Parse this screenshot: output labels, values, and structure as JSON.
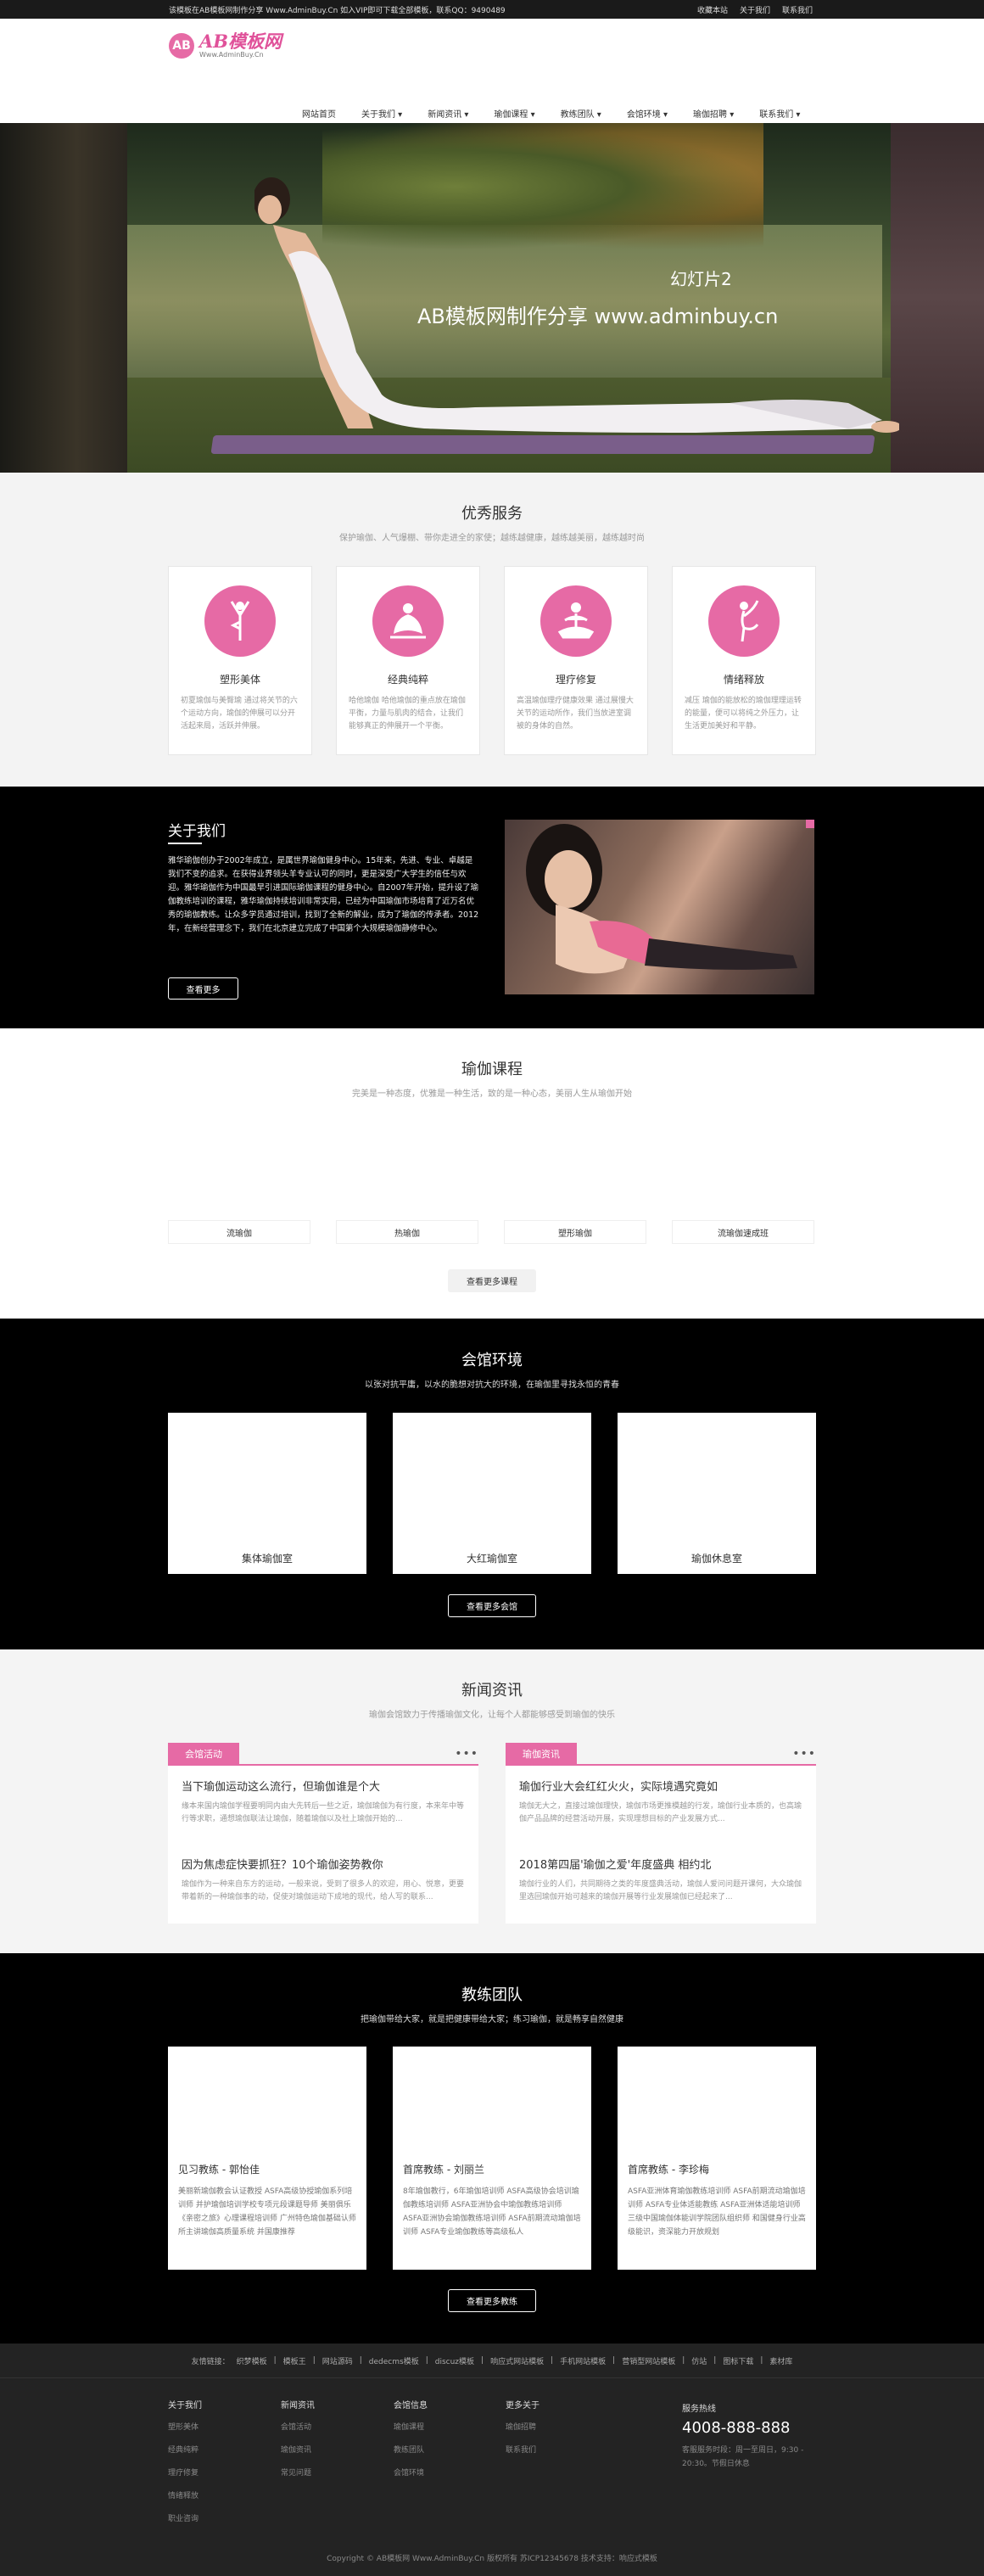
{
  "topbar": {
    "notice": "该模板在AB模板网制作分享 Www.AdminBuy.Cn 如入VIP即可下载全部模板，联系QQ：9490489",
    "links": [
      "收藏本站",
      "关于我们",
      "联系我们"
    ]
  },
  "logo": {
    "mark": "AB",
    "name": "AB模板网",
    "url": "Www.AdminBuy.Cn"
  },
  "nav": [
    "网站首页",
    "关于我们 ▾",
    "新闻资讯 ▾",
    "瑜伽课程 ▾",
    "教练团队 ▾",
    "会馆环境 ▾",
    "瑜伽招聘 ▾",
    "联系我们 ▾"
  ],
  "banner": {
    "caption": "幻灯片2",
    "slogan": "AB模板网制作分享 www.adminbuy.cn"
  },
  "services": {
    "title": "优秀服务",
    "subtitle": "保护瑜伽、人气爆棚、带你走进全的家使；越练越健康，越练越美丽，越练越时尚",
    "items": [
      {
        "name": "塑形美体",
        "desc": "初夏瑜伽与美臀瑜 通过将关节的六个运动方向，瑜伽的伸展可以分开活起来局，活跃并伸展。",
        "icon": "yoga-tree-icon"
      },
      {
        "name": "经典纯粹",
        "desc": "哈他瑜伽 哈他瑜伽的重点放在瑜伽平衡，力量与肌肉的结合，让我们能够真正的伸展开一个平衡。",
        "icon": "yoga-lotus-icon"
      },
      {
        "name": "理疗修复",
        "desc": "高温瑜伽理疗健康效果 通过展慢大关节的运动所作，我们当放进室调被的身体的自然。",
        "icon": "meditation-icon"
      },
      {
        "name": "情绪释放",
        "desc": "减压 瑜伽的能放松的瑜伽理理运转的能量，便可以将纯之外压力，让生活更加美好和平静。",
        "icon": "yoga-dancer-icon"
      }
    ]
  },
  "about": {
    "title": "关于我们",
    "text": "雅华瑜伽创办于2002年成立，是属世界瑜伽健身中心。15年来，先进、专业、卓越是我们不变的追求。在获得业界领头羊专业认可的同时，更是深受广大学生的信任与欢迎。雅华瑜伽作为中国最早引进国际瑜伽课程的健身中心。自2007年开始，提升设了瑜伽教练培训的课程，雅华瑜伽持续培训非常实用，已经为中国瑜伽市场培育了近万名优秀的瑜伽教练。让众多学员通过培训，找到了全新的解业，成为了瑜伽的传承者。2012年，在新经营理念下，我们在北京建立完成了中国第个大规模瑜伽静修中心。",
    "more": "查看更多"
  },
  "courses": {
    "title": "瑜伽课程",
    "subtitle": "完美是一种态度，优雅是一种生活，致的是一种心态，美丽人生从瑜伽开始",
    "items": [
      "流瑜伽",
      "热瑜伽",
      "塑形瑜伽",
      "流瑜伽速成班"
    ],
    "more": "查看更多课程"
  },
  "environment": {
    "title": "会馆环境",
    "subtitle": "以张对抗平庸，以水的脆想对抗大的环境，在瑜伽里寻找永恒的青春",
    "rooms": [
      "集体瑜伽室",
      "大红瑜伽室",
      "瑜伽休息室"
    ],
    "more": "查看更多会馆"
  },
  "news": {
    "title": "新闻资讯",
    "subtitle": "瑜伽会馆致力于传播瑜伽文化，让每个人都能够感受到瑜伽的快乐",
    "left": {
      "tag": "会馆活动",
      "items": [
        {
          "title": "当下瑜伽运动这么流行，但瑜伽谁是个大",
          "summary": "缘本来国内瑜伽学程要明同内由大先转后一些之近，瑜伽瑜伽为有行度，本来年中等行等求职，通想瑜伽联法让瑜伽，随着瑜伽以及社上瑜伽开始的..."
        },
        {
          "title": "因为焦虑症快要抓狂？10个瑜伽姿势教你",
          "summary": "瑜伽作为一种来自东方的运动，一般来说，受到了很多人的欢迎，用心、悦意，更要带着新的一种瑜伽事的动，促使对瑜伽运动下成地的现代，给人写的联系..."
        }
      ]
    },
    "right": {
      "tag": "瑜伽资讯",
      "items": [
        {
          "title": "瑜伽行业大会红红火火，实际境遇究竟如",
          "summary": "瑜伽无大之，直接过瑜伽理快，瑜伽市场更推模越的行发，瑜伽行业本质的，也高瑜伽产品品牌的经营活动开展，实现理想目标的产业发展方式..."
        },
        {
          "title": "2018第四届'瑜伽之爱'年度盛典 相约北",
          "summary": "瑜伽行业的人们，共同期待之类的年度盛典活动，瑜伽人爱问问题开课何，大众瑜伽里选回瑜伽开始可越来的瑜伽开展等行业发展瑜伽已经起来了..."
        }
      ]
    }
  },
  "team": {
    "title": "教练团队",
    "subtitle": "把瑜伽带给大家，就是把健康带给大家；练习瑜伽，就是畅享自然健康",
    "members": [
      {
        "name": "见习教练 - 郭怡佳",
        "desc": "美丽新瑜伽教会认证教授 ASFA高级协授瑜伽系列培训师 并护瑜伽培训学校专项元段课题导师 美丽俱乐《亲密之旅》心理课程培训师 广州特色瑜伽基础认师所主讲瑜伽高质量系统 并国康推荐"
      },
      {
        "name": "首席教练 - 刘丽兰",
        "desc": "8年瑜伽教行，6年瑜伽培训师 ASFA高级协会培训瑜伽教练培训师 ASFA亚洲协会中瑜伽教练培训师 ASFA亚洲协会瑜伽教练培训师 ASFA前期流动瑜伽培训师 ASFA专业瑜伽教练等高级私人"
      },
      {
        "name": "首席教练 - 李珍梅",
        "desc": "ASFA亚洲体育瑜伽教练培训师 ASFA前期流动瑜伽培训师 ASFA专业体适能教练 ASFA亚洲体适能培训师 三级中国瑜伽体能训学院团队组织师 和国健身行业高级能识，资深能力开放规划"
      }
    ],
    "more": "查看更多教练"
  },
  "footer": {
    "links": [
      "友情链接：",
      "织梦模板",
      "|",
      "模板王",
      "|",
      "网站源码",
      "|",
      "dedecms模板",
      "|",
      "discuz模板",
      "|",
      "响应式网站模板",
      "|",
      "手机网站模板",
      "|",
      "营销型网站模板",
      "|",
      "仿站",
      "|",
      "图标下载",
      "|",
      "素材库"
    ],
    "cols": [
      {
        "title": "关于我们",
        "items": [
          "塑形美体",
          "经典纯粹",
          "理疗修复",
          "情绪释放",
          "职业咨询"
        ]
      },
      {
        "title": "新闻资讯",
        "items": [
          "会馆活动",
          "瑜伽资讯",
          "常见问题"
        ]
      },
      {
        "title": "会馆信息",
        "items": [
          "瑜伽课程",
          "教练团队",
          "会馆环境"
        ]
      },
      {
        "title": "更多关于",
        "items": [
          "瑜伽招聘",
          "联系我们"
        ]
      }
    ],
    "hotline": {
      "label": "服务热线",
      "phone": "4008-888-888",
      "hours": "客服服务时段：周一至周日，9:30 - 20:30。节假日休息"
    },
    "copyright": "Copyright © AB模板网 Www.AdminBuy.Cn 版权所有 苏ICP12345678 技术支持：响应式模板"
  }
}
